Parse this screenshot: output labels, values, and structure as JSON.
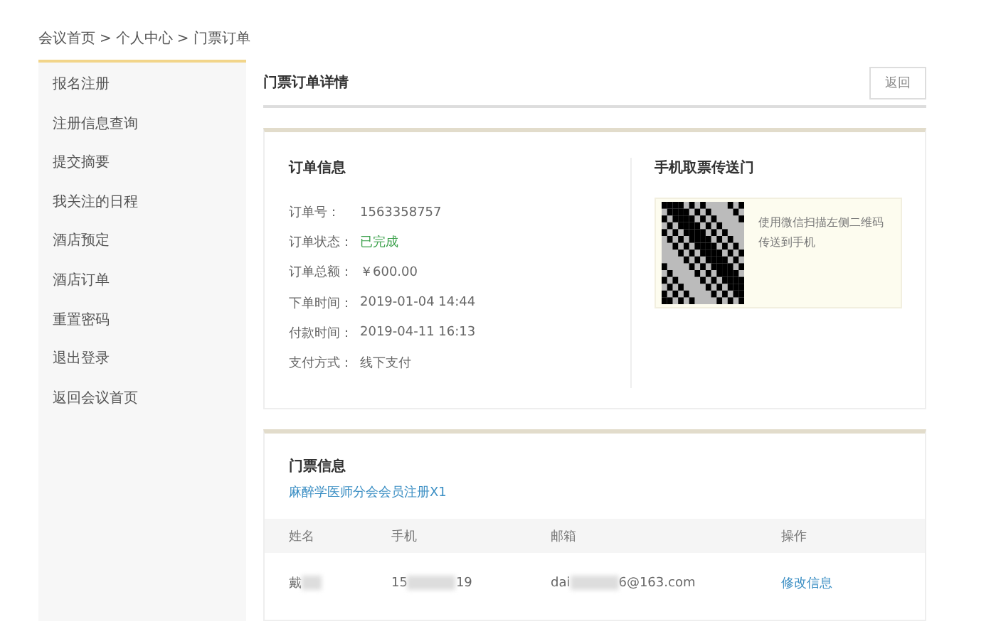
{
  "breadcrumb": {
    "items": [
      "会议首页",
      "个人中心",
      "门票订单"
    ],
    "separator": ">"
  },
  "sidebar": {
    "items": [
      {
        "label": "报名注册"
      },
      {
        "label": "注册信息查询"
      },
      {
        "label": "提交摘要"
      },
      {
        "label": "我关注的日程"
      },
      {
        "label": "酒店预定"
      },
      {
        "label": "酒店订单"
      },
      {
        "label": "重置密码"
      },
      {
        "label": "退出登录"
      },
      {
        "label": "返回会议首页"
      }
    ]
  },
  "page_title": "门票订单详情",
  "back_button": "返回",
  "order_info": {
    "title": "订单信息",
    "fields": [
      {
        "label": "订单号：",
        "value": "1563358757",
        "kind": "plain"
      },
      {
        "label": "订单状态：",
        "value": "已完成",
        "kind": "status"
      },
      {
        "label": "订单总额：",
        "value": "￥600.00",
        "kind": "plain"
      },
      {
        "label": "下单时间：",
        "value": "2019-01-04 14:44",
        "kind": "plain"
      },
      {
        "label": "付款时间：",
        "value": "2019-04-11 16:13",
        "kind": "plain"
      },
      {
        "label": "支付方式：",
        "value": "线下支付",
        "kind": "plain"
      }
    ]
  },
  "mobile_ticket": {
    "title": "手机取票传送门",
    "hint": "使用微信扫描左侧二维码传送到手机"
  },
  "ticket_info": {
    "title": "门票信息",
    "ticket_link": "麻醉学医师分会会员注册X1",
    "table": {
      "columns": [
        "姓名",
        "手机",
        "邮箱",
        "操作"
      ],
      "rows": [
        {
          "cells": [
            {
              "parts": [
                "戴"
              ],
              "masked_tail": true
            },
            {
              "parts": [
                "15",
                "19"
              ],
              "masked_tail": false
            },
            {
              "parts": [
                "dai",
                "6@163.com"
              ],
              "masked_tail": false
            }
          ],
          "action": "修改信息"
        }
      ]
    }
  }
}
